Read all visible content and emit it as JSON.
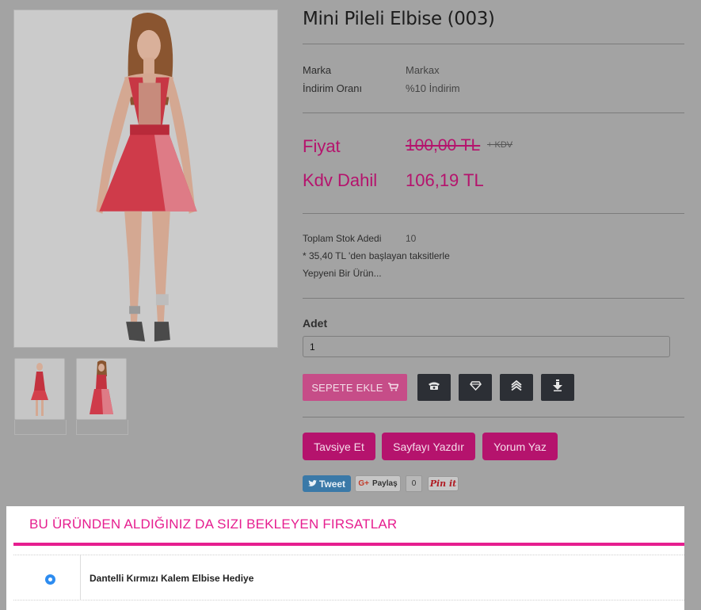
{
  "product": {
    "title": "Mini Pileli Elbise (003)",
    "brand_label": "Marka",
    "brand_value": "Markax",
    "discount_label": "İndirim Oranı",
    "discount_value": "%10 İndirim",
    "price_label": "Fiyat",
    "old_price": "100,00 TL",
    "kdv_note": "+ KDV",
    "kdv_label": "Kdv Dahil",
    "new_price": "106,19 TL",
    "stock_label": "Toplam Stok Adedi",
    "stock_value": "10",
    "installment_text": "* 35,40 TL 'den başlayan taksitlerle",
    "condition_text": "Yepyeni Bir Ürün...",
    "quantity_label": "Adet",
    "quantity_value": "1"
  },
  "actions": {
    "add_to_cart": "SEPETE EKLE",
    "icons": [
      "phone-icon",
      "diamond-icon",
      "layers-icon",
      "download-icon"
    ],
    "recommend": "Tavsiye Et",
    "print_page": "Sayfayı Yazdır",
    "write_review": "Yorum Yaz"
  },
  "social": {
    "tweet": "Tweet",
    "gplus": "Paylaş",
    "gplus_prefix": "G+",
    "gplus_count": "0",
    "pinit": "Pin it"
  },
  "offers": {
    "title": "BU ÜRÜNDEN ALDIĞINIZ DA SIZI BEKLEYEN FIRSATLAR",
    "items": [
      {
        "name": "Dantelli Kırmızı Kalem Elbise Hediye",
        "selected": true
      }
    ]
  },
  "colors": {
    "accent": "#b5136d",
    "offer_accent": "#e61e8f",
    "dark_button": "#2c2f35",
    "radio": "#2d8cf0"
  }
}
